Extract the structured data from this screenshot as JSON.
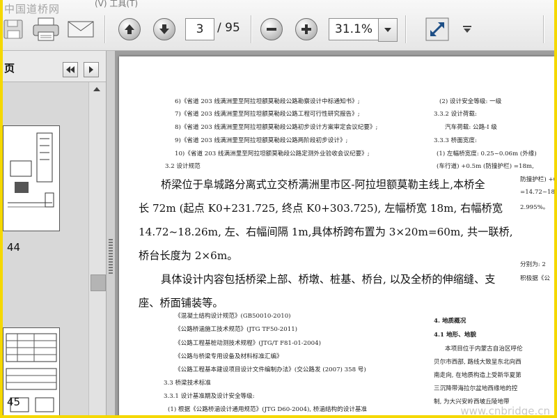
{
  "watermark_title": "中国道桥网",
  "menu_fragment": "(V)   工具(T)",
  "toolbar": {
    "current_page": "3",
    "total_pages": "/ 95",
    "zoom": "31.1%"
  },
  "panel": {
    "title": "页",
    "thumbnails": [
      {
        "label": "44"
      },
      {
        "label": "45"
      }
    ]
  },
  "document": {
    "small_left_lines": [
      "6)《省道 203 线满洲里至阿拉坦额莫勒段公路勘察设计中标通知书》;",
      "7)《省道 203 线满洲里至阿拉坦额莫勒段公路工程可行性研究报告》;",
      "8)《省道 203 线满洲里至阿拉坦额莫勒段公路初步设计方案审定会议纪要》;",
      "9)《省道 203 线满洲里至阿拉坦额莫勒段公路两阶段初步设计》;",
      "10)《省道 203 线满洲里至阿拉坦额莫勒段公路定测外业验收会议纪要》;",
      "3.2 设计规范"
    ],
    "small_right_lines": [
      "(2) 设计安全等级: 一级",
      "3.3.2 设计荷载:",
      "汽车荷载: 公路-I 级",
      "3.3.3 桥面宽度:",
      "(1) 左幅桥宽度: 0.25~0.06m (外缘)",
      "(车行道) +0.5m (防撞护栏) =18m,"
    ],
    "big_lines": [
      "桥梁位于阜城路分离式立交桥满洲里市区-阿拉坦额莫勒主线上,本桥全",
      "长 72m (起点 K0+231.725, 终点 K0+303.725), 左幅桥宽 18m, 右幅桥宽",
      "14.72~18.26m, 左、右幅间隔 1m,具体桥跨布置为 3×20m=60m, 共一联桥,",
      "桥台长度为 2×6m。",
      "具体设计内容包括桥梁上部、桥墩、桩基、桥台, 以及全桥的伸缩缝、支",
      "座、桥面铺装等。"
    ],
    "right_fragments": [
      "防撞护栏) +0.5",
      "=14.72~18.",
      "2.995%。",
      "分别为: 2",
      "积极据《公"
    ],
    "small_lower_lines": [
      "《混凝土结构设计规范》(GB50010-2010)",
      "《公路桥涵施工技术规范》(JTG TF50-2011)",
      "《公路工程基桩动测技术规程》(JTG/T F81-01-2004)",
      "《公路与桥梁专用设备及材料标准汇编》",
      "《公路工程基本建设项目设计文件编制办法》(交公路发 (2007) 358 号)",
      "3.3 桥梁技术标准",
      "3.3.1 设计基准期及设计安全等级:",
      "(1) 根据《公路桥涵设计通用规范》(JTG D60-2004), 桥涵结构的设计基准"
    ],
    "right_lower_lines": [
      "4. 地质概况",
      "4.1 地形、地貌",
      "本项目位于内蒙古自治区呼伦",
      "贝尔市西部, 路线大致呈东北向西",
      "南走向, 在地质构造上受新华夏第",
      "三沉降带海拉尔盆地西缘地的控",
      "制, 为大兴安岭西坡丘陵地带"
    ],
    "site_watermark": "www.cnbridge.cn"
  }
}
